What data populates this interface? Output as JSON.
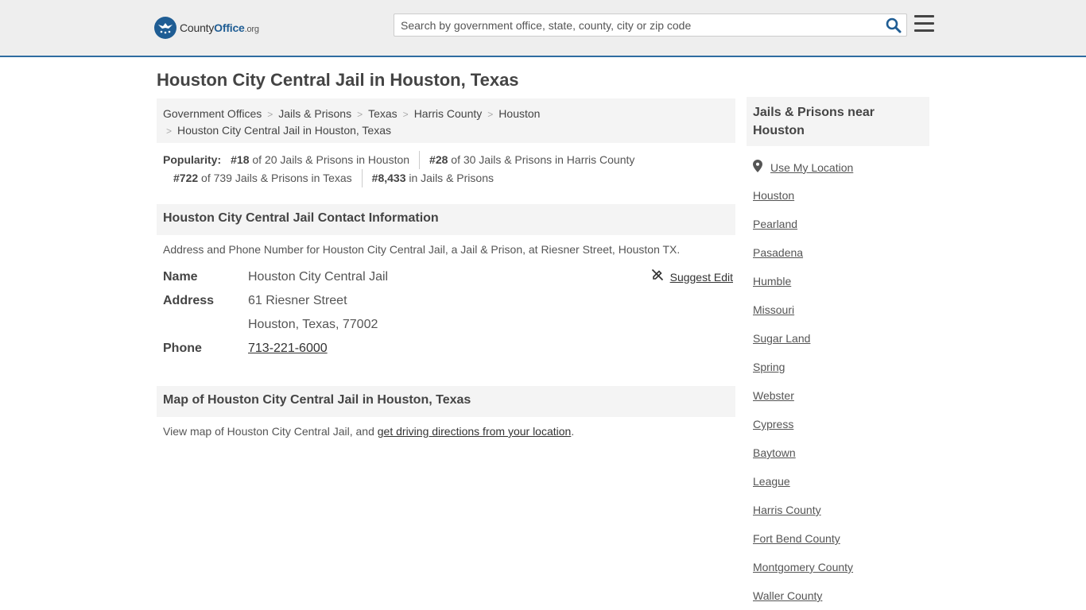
{
  "header": {
    "logo": {
      "county": "County",
      "office": "Office",
      "org": ".org"
    },
    "search_placeholder": "Search by government office, state, county, city or zip code"
  },
  "page_title": "Houston City Central Jail in Houston, Texas",
  "breadcrumb": {
    "items": [
      "Government Offices",
      "Jails & Prisons",
      "Texas",
      "Harris County",
      "Houston"
    ],
    "current": "Houston City Central Jail in Houston, Texas",
    "separator": ">"
  },
  "popularity": {
    "label": "Popularity:",
    "items": [
      {
        "rank": "#18",
        "text": "of 20 Jails & Prisons in Houston"
      },
      {
        "rank": "#28",
        "text": "of 30 Jails & Prisons in Harris County"
      },
      {
        "rank": "#722",
        "text": "of 739 Jails & Prisons in Texas"
      },
      {
        "rank": "#8,433",
        "text": "in Jails & Prisons"
      }
    ]
  },
  "contact": {
    "heading": "Houston City Central Jail Contact Information",
    "description": "Address and Phone Number for Houston City Central Jail, a Jail & Prison, at Riesner Street, Houston TX.",
    "suggest_edit": "Suggest Edit",
    "name_label": "Name",
    "name_value": "Houston City Central Jail",
    "address_label": "Address",
    "address_line1": "61 Riesner Street",
    "address_line2": "Houston, Texas, 77002",
    "phone_label": "Phone",
    "phone_value": "713-221-6000"
  },
  "map": {
    "heading": "Map of Houston City Central Jail in Houston, Texas",
    "text_before": "View map of Houston City Central Jail, and ",
    "link": "get driving directions from your location",
    "text_after": "."
  },
  "sidebar": {
    "heading": "Jails & Prisons near Houston",
    "use_location": "Use My Location",
    "links": [
      "Houston",
      "Pearland",
      "Pasadena",
      "Humble",
      "Missouri",
      "Sugar Land",
      "Spring",
      "Webster",
      "Cypress",
      "Baytown",
      "League",
      "Harris County",
      "Fort Bend County",
      "Montgomery County",
      "Waller County"
    ]
  },
  "colors": {
    "accent": "#1f5d94",
    "topbar": "#eeeeee",
    "panel": "#f4f4f4"
  }
}
